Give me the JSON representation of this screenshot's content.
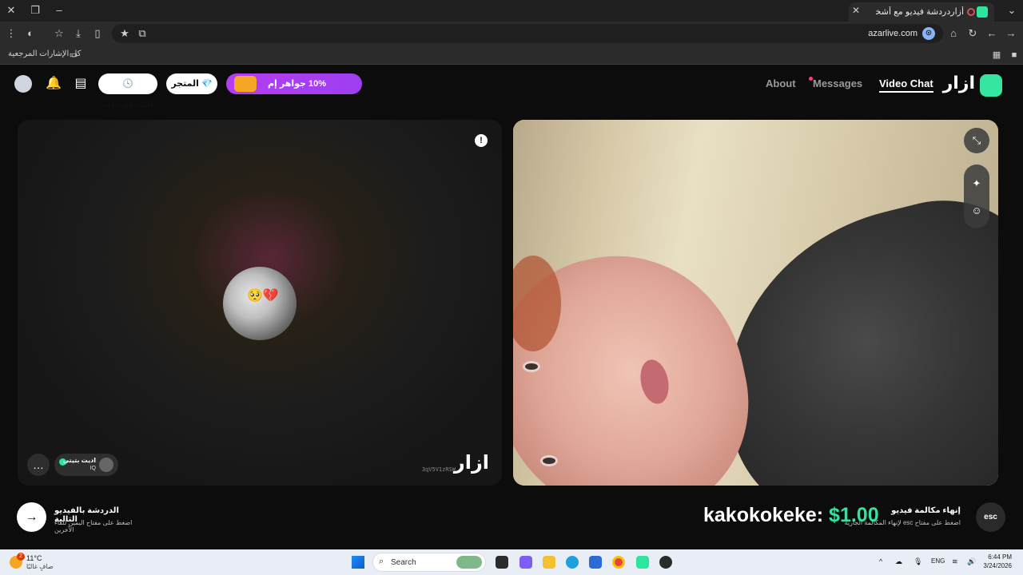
{
  "browser": {
    "tab_title": "أزاردردشة فيديو مع أشخاص",
    "url": "azarlive.com",
    "bookmarks_label": "كل الإشارات المرجعية"
  },
  "header": {
    "logo_text": "ازار",
    "nav": {
      "video_chat": "Video Chat",
      "messages": "Messages",
      "about": "About"
    },
    "promo_text": "10% جواهر إم",
    "shop_label": "المتجر",
    "saved_label": "المحفوظات"
  },
  "left_video": {
    "watermark": "ازار",
    "room_id": "3qV5V1zRSW",
    "peer_name": "اديت بتيتي",
    "peer_country": "IQ",
    "avatar_emoji": "🥺💔"
  },
  "footer": {
    "next_title": "الدردشة بالفيديو التالية",
    "next_sub": "اضغط على مفتاح اليمين للقاء الآخرين",
    "end_title": "إنهاء مكالمة فيديو",
    "end_sub": "اضغط على مفتاح esc لإنهاء المكالمة الجارية",
    "esc_label": "esc",
    "overlay_name": "kakokokeke: ",
    "overlay_amount": "$1.00"
  },
  "taskbar": {
    "weather_temp": "11°C",
    "weather_desc": "صافٍ غالبًا",
    "weather_badge": "2",
    "search_label": "Search",
    "lang": "ENG",
    "time": "6:44 PM",
    "date": "3/24/2026"
  },
  "colors": {
    "brand_green": "#2ee59d",
    "promo_purple": "#a83ef2",
    "notif_red": "#ff3d71"
  }
}
